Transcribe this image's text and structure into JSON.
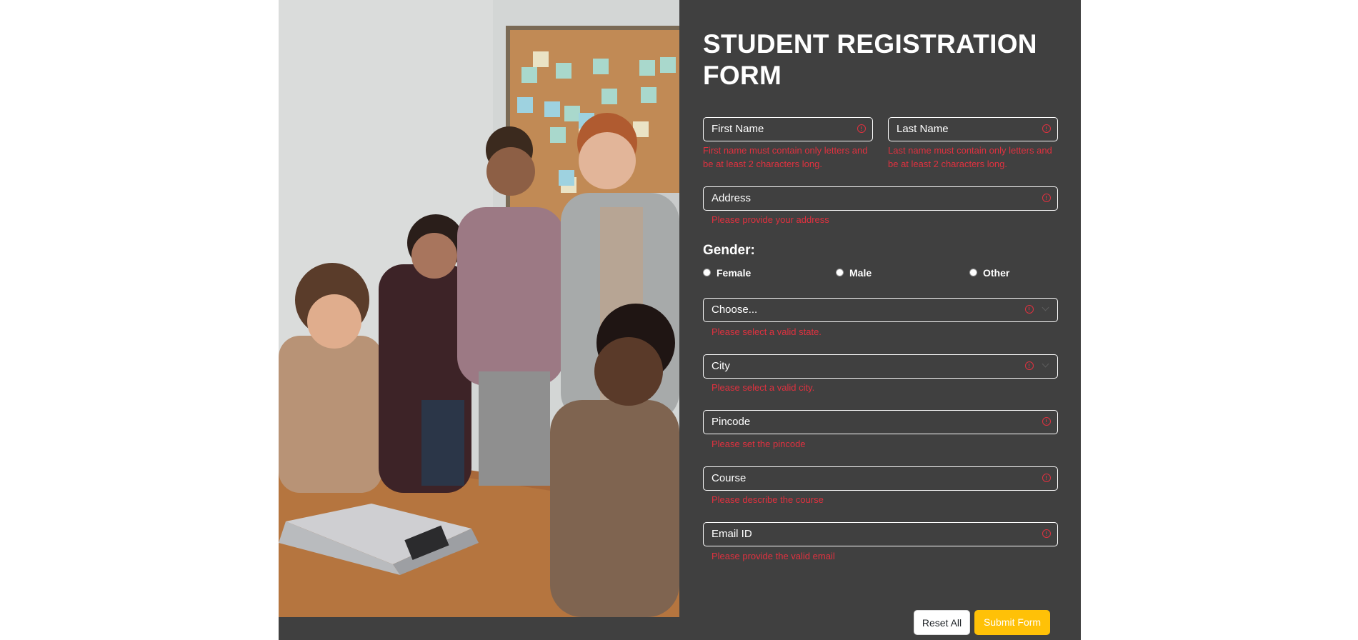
{
  "form": {
    "title": "STUDENT REGISTRATION FORM",
    "first_name": {
      "placeholder": "First Name",
      "error": "First name must contain only letters and be at least 2 characters long."
    },
    "last_name": {
      "placeholder": "Last Name",
      "error": "Last name must contain only letters and be at least 2 characters long."
    },
    "address": {
      "placeholder": "Address",
      "error": "Please provide your address"
    },
    "gender": {
      "label": "Gender:",
      "options": [
        "Female",
        "Male",
        "Other"
      ]
    },
    "state": {
      "value": "Choose...",
      "error": "Please select a valid state."
    },
    "city": {
      "value": "City",
      "error": "Please select a valid city."
    },
    "pincode": {
      "placeholder": "Pincode",
      "error": "Please set the pincode"
    },
    "course": {
      "placeholder": "Course",
      "error": "Please describe the course"
    },
    "email": {
      "placeholder": "Email ID",
      "error": "Please provide the valid email"
    },
    "buttons": {
      "reset": "Reset All",
      "submit": "Submit Form"
    }
  },
  "colors": {
    "panel": "#404040",
    "error": "#e0313f",
    "submit": "#ffc107"
  },
  "icons": [
    "error-icon",
    "chevron-down-icon"
  ]
}
